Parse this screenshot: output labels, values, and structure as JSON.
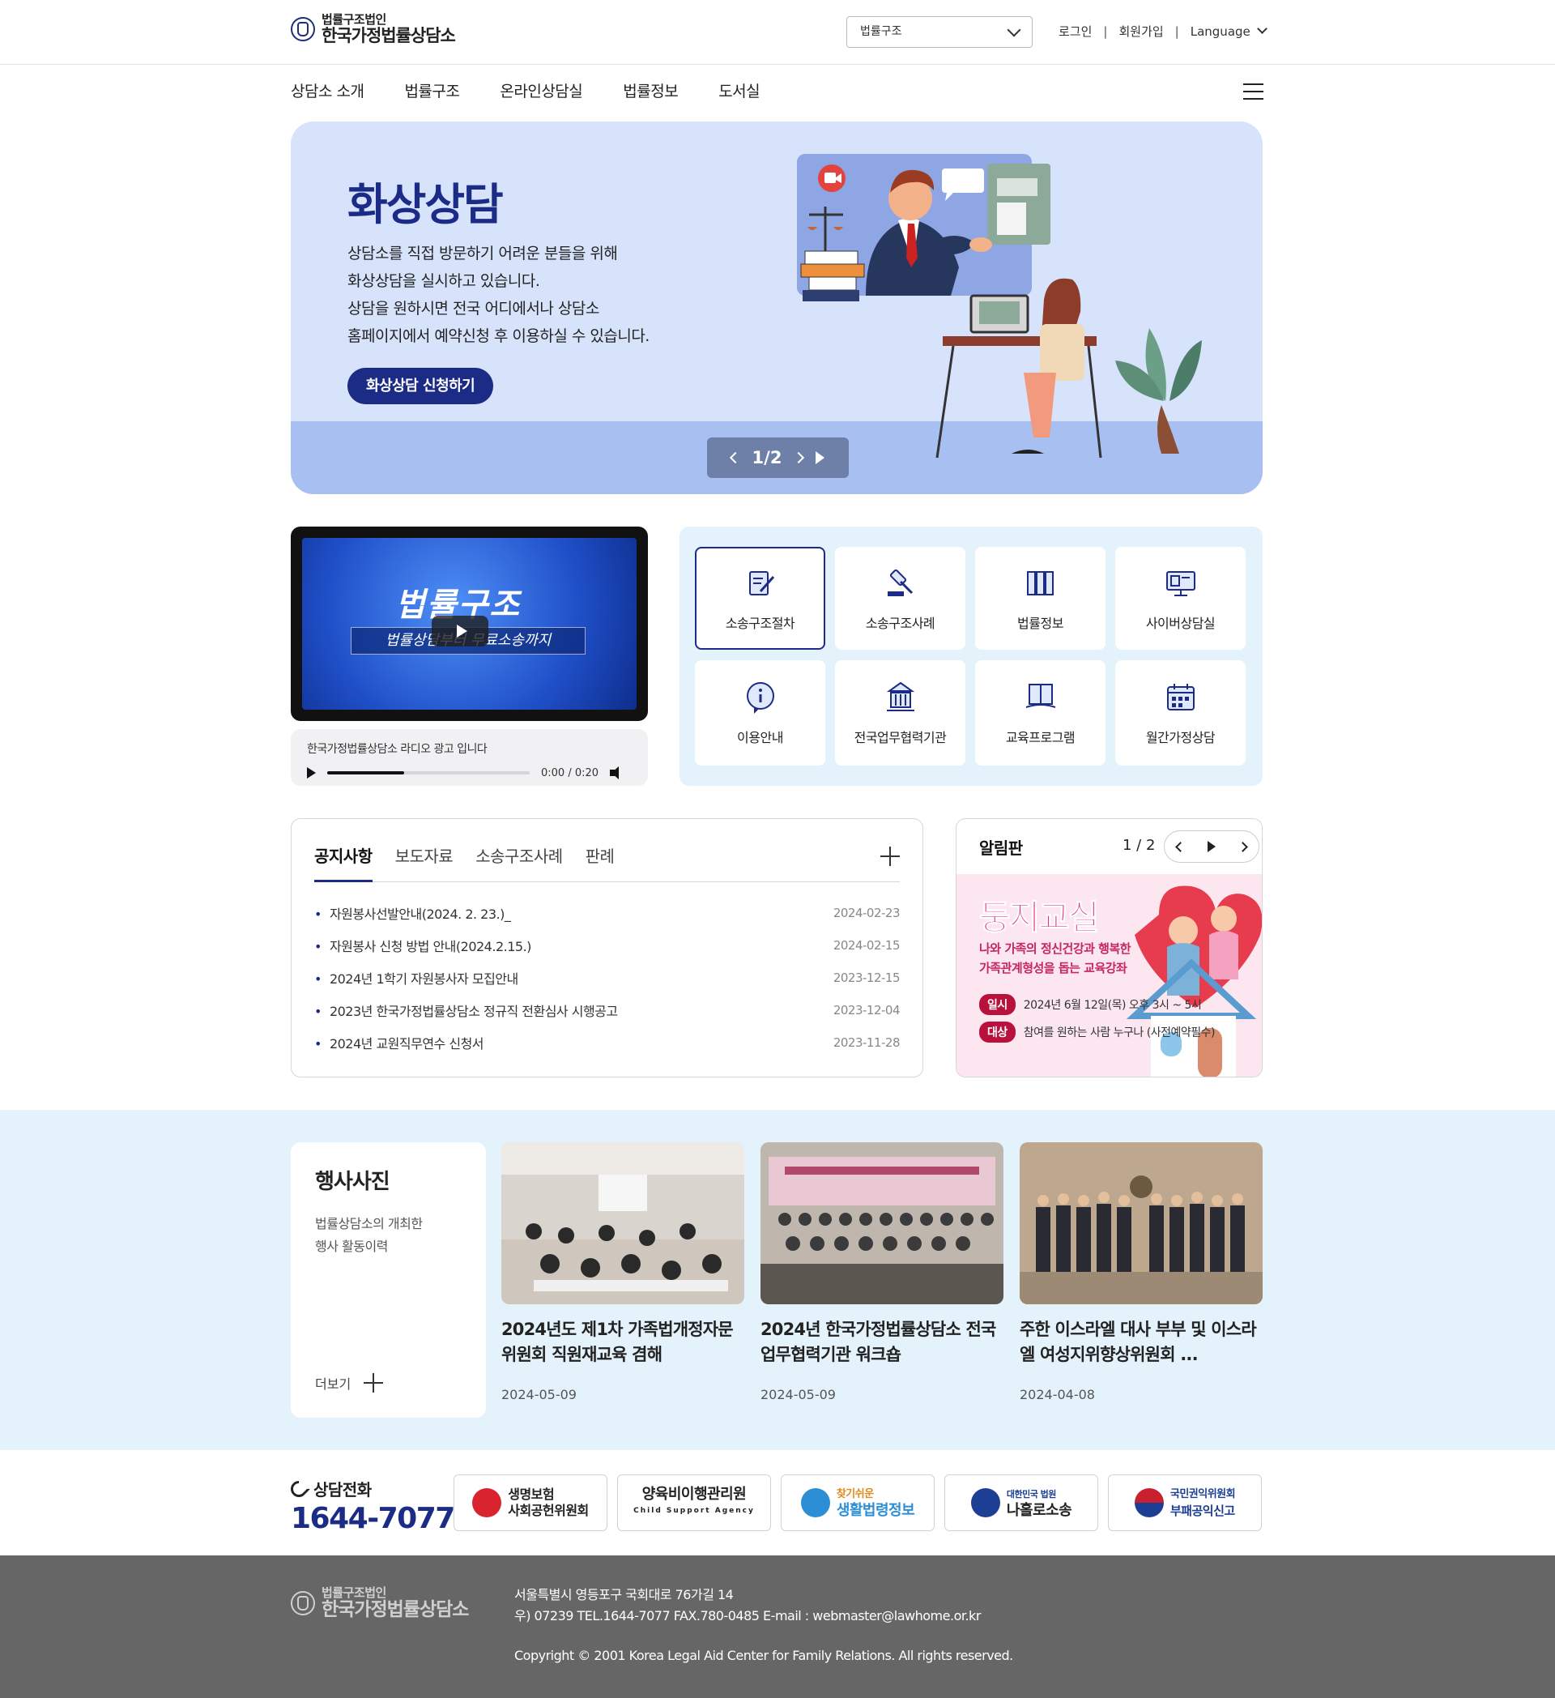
{
  "header": {
    "logo_sub": "법률구조법인",
    "logo_main": "한국가정법률상담소",
    "site_select": "법률구조",
    "login": "로그인",
    "signup": "회원가입",
    "language": "Language"
  },
  "gnb": [
    "상담소 소개",
    "법률구조",
    "온라인상담실",
    "법률정보",
    "도서실"
  ],
  "hero": {
    "title": "화상상담",
    "desc": [
      "상담소를 직접 방문하기 어려운 분들을 위해",
      "화상상담을 실시하고 있습니다.",
      "상담을 원하시면 전국 어디에서나 상담소",
      "홈페이지에서 예약신청 후 이용하실 수 있습니다."
    ],
    "button": "화상상담 신청하기",
    "pager": "1/2"
  },
  "video": {
    "caption1": "법률구조",
    "caption2": "법률상담부터 무료소송까지"
  },
  "audio": {
    "title": "한국가정법률상담소 라디오 광고 입니다",
    "time": "0:00 / 0:20",
    "progress": 0.38
  },
  "quick": [
    {
      "label": "소송구조절차",
      "icon": "document-pen-icon",
      "active": true
    },
    {
      "label": "소송구조사례",
      "icon": "gavel-icon",
      "active": false
    },
    {
      "label": "법률정보",
      "icon": "binders-icon",
      "active": false
    },
    {
      "label": "사이버상담실",
      "icon": "monitor-icon",
      "active": false
    },
    {
      "label": "이용안내",
      "icon": "info-chat-icon",
      "active": false
    },
    {
      "label": "전국업무협력기관",
      "icon": "building-icon",
      "active": false
    },
    {
      "label": "교육프로그램",
      "icon": "open-book-icon",
      "active": false
    },
    {
      "label": "월간가정상담",
      "icon": "calendar-icon",
      "active": false
    }
  ],
  "board": {
    "tabs": [
      "공지사항",
      "보도자료",
      "소송구조사례",
      "판례"
    ],
    "notices": [
      {
        "title": "자원봉사선발안내(2024. 2. 23.)_",
        "date": "2024-02-23"
      },
      {
        "title": "자원봉사 신청 방법 안내(2024.2.15.)",
        "date": "2024-02-15"
      },
      {
        "title": "2024년 1학기 자원봉사자 모집안내",
        "date": "2023-12-15"
      },
      {
        "title": "2023년 한국가정법률상담소 정규직 전환심사 시행공고",
        "date": "2023-12-04"
      },
      {
        "title": "2024년 교원직무연수 신청서",
        "date": "2023-11-28"
      }
    ]
  },
  "alert": {
    "title": "알림판",
    "count": "1 / 2",
    "banner_title": "둥지교실",
    "banner_sub1": "나와 가족의 정신건강과 행복한",
    "banner_sub2": "가족관계형성을 돕는 교육강좌",
    "tag1": "일시",
    "row1": "2024년 6월 12일(목) 오후 3시 ~ 5시",
    "tag2": "대상",
    "row2": "참여를 원하는 사람 누구나 (사전예약필수)"
  },
  "gallery": {
    "title": "행사사진",
    "desc1": "법률상담소의 개최한",
    "desc2": "행사 활동이력",
    "more": "더보기",
    "cards": [
      {
        "title": "2024년도 제1차 가족법개정자문위원회 직원재교육 겸해",
        "date": "2024-05-09"
      },
      {
        "title": "2024년 한국가정법률상담소 전국업무협력기관 워크숍",
        "date": "2024-05-09"
      },
      {
        "title": "주한 이스라엘 대사 부부 및 이스라엘 여성지위향상위원회 ...",
        "date": "2024-04-08"
      }
    ]
  },
  "contact": {
    "label": "상담전화",
    "number": "1644-7077"
  },
  "partners": [
    {
      "line1": "생명보험",
      "line2": "사회공헌위원회",
      "color": "#d9242e"
    },
    {
      "line1": "양육비이행관리원",
      "line2": "Child Support Agency",
      "color": "#333333"
    },
    {
      "line1": "찾기쉬운",
      "line2": "생활법령정보",
      "color": "#2c8fd6"
    },
    {
      "line1": "대한민국 법원",
      "line2": "나홀로소송",
      "color": "#1c3f94"
    },
    {
      "line1": "국민권익위원회",
      "line2": "부패공익신고",
      "color": "#c8202f"
    }
  ],
  "footer": {
    "logo_sub": "법률구조법인",
    "logo_main": "한국가정법률상담소",
    "address": "서울특별시 영등포구 국회대로 76가길 14",
    "contact": "우) 07239   TEL.1644-7077   FAX.780-0485   E-mail : webmaster@lawhome.or.kr",
    "copyright": "Copyright © 2001 Korea Legal Aid Center for Family Relations.   All rights reserved."
  }
}
